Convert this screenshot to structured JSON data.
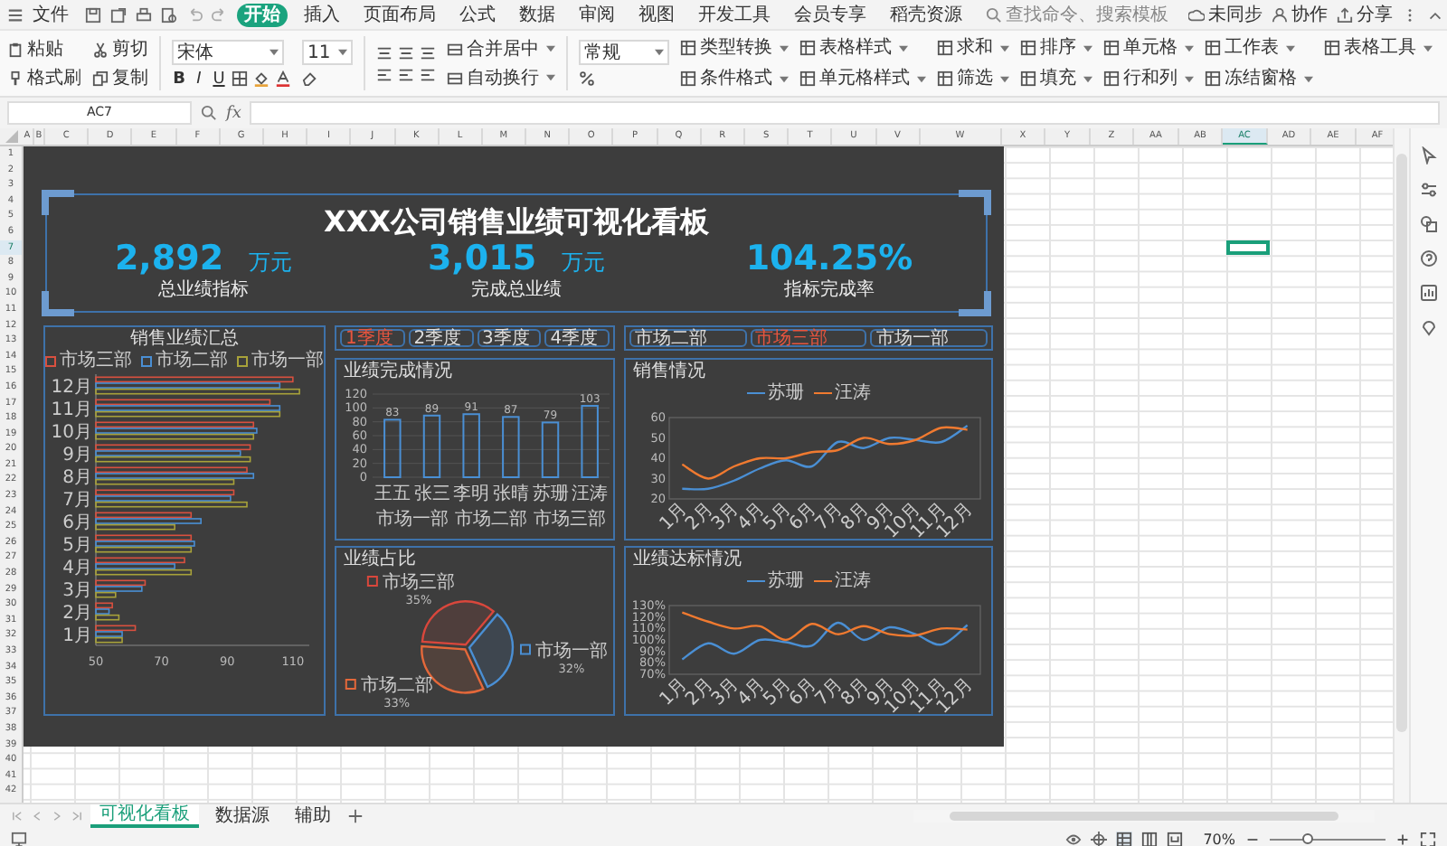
{
  "menu_bar": {
    "file_menu": "文件",
    "tabs": [
      {
        "label": "开始",
        "selected": true
      },
      {
        "label": "插入",
        "selected": false
      },
      {
        "label": "页面布局",
        "selected": false
      },
      {
        "label": "公式",
        "selected": false
      },
      {
        "label": "数据",
        "selected": false
      },
      {
        "label": "审阅",
        "selected": false
      },
      {
        "label": "视图",
        "selected": false
      },
      {
        "label": "开发工具",
        "selected": false
      },
      {
        "label": "会员专享",
        "selected": false
      },
      {
        "label": "稻壳资源",
        "selected": false
      }
    ],
    "search": {
      "placeholder": "查找命令、搜索模板"
    },
    "actions": [
      "未同步",
      "协作",
      "分享"
    ]
  },
  "ribbon": {
    "clipboard": [
      "粘贴",
      "格式刷",
      "剪切",
      "复制"
    ],
    "font": {
      "name": "宋体",
      "size": "11",
      "styles": [
        "B",
        "I",
        "U"
      ]
    },
    "alignment": [
      "合并居中",
      "自动换行"
    ],
    "number_format": "常规",
    "tools": [
      "类型转换",
      "条件格式",
      "表格样式",
      "单元格样式",
      "求和",
      "筛选",
      "排序",
      "填充",
      "单元格",
      "行和列",
      "工作表",
      "冻结窗格",
      "表格工具"
    ]
  },
  "formula_bar": {
    "cell_name": "AC7",
    "function_label": "fx"
  },
  "sheet": {
    "columns": [
      {
        "label": "A",
        "selected": false
      },
      {
        "label": "B",
        "selected": false
      },
      {
        "label": "C",
        "selected": false
      },
      {
        "label": "D",
        "selected": false
      },
      {
        "label": "E",
        "selected": false
      },
      {
        "label": "F",
        "selected": false
      },
      {
        "label": "G",
        "selected": false
      },
      {
        "label": "H",
        "selected": false
      },
      {
        "label": "I",
        "selected": false
      },
      {
        "label": "J",
        "selected": false
      },
      {
        "label": "K",
        "selected": false
      },
      {
        "label": "L",
        "selected": false
      },
      {
        "label": "M",
        "selected": false
      },
      {
        "label": "N",
        "selected": false
      },
      {
        "label": "O",
        "selected": false
      },
      {
        "label": "P",
        "selected": false
      },
      {
        "label": "Q",
        "selected": false
      },
      {
        "label": "R",
        "selected": false
      },
      {
        "label": "S",
        "selected": false
      },
      {
        "label": "T",
        "selected": false
      },
      {
        "label": "U",
        "selected": false
      },
      {
        "label": "V",
        "selected": false
      },
      {
        "label": "W",
        "selected": false
      },
      {
        "label": "X",
        "selected": false
      },
      {
        "label": "Y",
        "selected": false
      },
      {
        "label": "Z",
        "selected": false
      },
      {
        "label": "AA",
        "selected": false
      },
      {
        "label": "AB",
        "selected": false
      },
      {
        "label": "AC",
        "selected": true
      },
      {
        "label": "AD",
        "selected": false
      },
      {
        "label": "AE",
        "selected": false
      },
      {
        "label": "AF",
        "selected": false
      }
    ],
    "rows": [
      {
        "label": "1",
        "selected": false
      },
      {
        "label": "2",
        "selected": false
      },
      {
        "label": "3",
        "selected": false
      },
      {
        "label": "4",
        "selected": false
      },
      {
        "label": "5",
        "selected": false
      },
      {
        "label": "6",
        "selected": false
      },
      {
        "label": "7",
        "selected": true
      },
      {
        "label": "8",
        "selected": false
      },
      {
        "label": "9",
        "selected": false
      },
      {
        "label": "10",
        "selected": false
      },
      {
        "label": "11",
        "selected": false
      },
      {
        "label": "12",
        "selected": false
      },
      {
        "label": "13",
        "selected": false
      },
      {
        "label": "14",
        "selected": false
      },
      {
        "label": "15",
        "selected": false
      },
      {
        "label": "16",
        "selected": false
      },
      {
        "label": "17",
        "selected": false
      },
      {
        "label": "18",
        "selected": false
      },
      {
        "label": "19",
        "selected": false
      },
      {
        "label": "20",
        "selected": false
      },
      {
        "label": "21",
        "selected": false
      },
      {
        "label": "22",
        "selected": false
      },
      {
        "label": "23",
        "selected": false
      },
      {
        "label": "24",
        "selected": false
      },
      {
        "label": "25",
        "selected": false
      },
      {
        "label": "26",
        "selected": false
      },
      {
        "label": "27",
        "selected": false
      },
      {
        "label": "28",
        "selected": false
      },
      {
        "label": "29",
        "selected": false
      },
      {
        "label": "30",
        "selected": false
      },
      {
        "label": "31",
        "selected": false
      },
      {
        "label": "32",
        "selected": false
      },
      {
        "label": "33",
        "selected": false
      },
      {
        "label": "34",
        "selected": false
      },
      {
        "label": "35",
        "selected": false
      },
      {
        "label": "36",
        "selected": false
      },
      {
        "label": "37",
        "selected": false
      },
      {
        "label": "38",
        "selected": false
      },
      {
        "label": "39",
        "selected": false
      },
      {
        "label": "40",
        "selected": false
      },
      {
        "label": "41",
        "selected": false
      },
      {
        "label": "42",
        "selected": false
      }
    ],
    "dashboard": {
      "title": "XXX公司销售业绩可视化看板",
      "kpis": [
        {
          "value": "2,892",
          "unit": "万元",
          "label": "总业绩指标"
        },
        {
          "value": "3,015",
          "unit": "万元",
          "label": "完成总业绩"
        },
        {
          "value": "104.25%",
          "label": "指标完成率"
        }
      ],
      "summary_chart": {
        "chart_data": {
          "type": "bar",
          "orientation": "horizontal",
          "title": "销售业绩汇总",
          "categories": [
            "12月",
            "11月",
            "10月",
            "9月",
            "8月",
            "7月",
            "6月",
            "5月",
            "4月",
            "3月",
            "2月",
            "1月"
          ],
          "series": [
            {
              "name": "市场三部",
              "color": "#d9503f",
              "values": [
                110,
                103,
                98,
                97,
                96,
                92,
                79,
                79,
                77,
                65,
                55,
                62
              ]
            },
            {
              "name": "市场二部",
              "color": "#4a8fd4",
              "values": [
                106,
                106,
                99,
                94,
                98,
                91,
                82,
                80,
                74,
                64,
                54,
                58
              ]
            },
            {
              "name": "市场一部",
              "color": "#a8a23a",
              "values": [
                112,
                106,
                98,
                97,
                92,
                96,
                74,
                79,
                79,
                56,
                57,
                58
              ]
            }
          ],
          "xlim": [
            50,
            115
          ],
          "xticks": [
            50,
            70,
            90,
            110
          ],
          "legend": "top"
        }
      },
      "quarter_buttons": [
        {
          "label": "1季度",
          "selected": true
        },
        {
          "label": "2季度",
          "selected": false
        },
        {
          "label": "3季度",
          "selected": false
        },
        {
          "label": "4季度",
          "selected": false
        }
      ],
      "completion_chart": {
        "chart_data": {
          "type": "bar",
          "title": "业绩完成情况",
          "categories": [
            "王五",
            "张三",
            "李明",
            "张晴",
            "苏珊",
            "汪涛"
          ],
          "values": [
            83,
            89,
            91,
            87,
            79,
            103
          ],
          "ylim": [
            0,
            120
          ],
          "yticks": [
            0,
            20,
            40,
            60,
            80,
            100,
            120
          ],
          "grid": true,
          "data_labels": true
        },
        "group_labels": [
          "市场一部",
          "市场二部",
          "市场三部"
        ]
      },
      "share_chart": {
        "chart_data": {
          "type": "pie",
          "title": "业绩占比",
          "categories": [
            "市场一部",
            "市场二部",
            "市场三部"
          ],
          "values": [
            32,
            33,
            35
          ],
          "colors": [
            "#4a8fd4",
            "#e4683a",
            "#d9473c"
          ],
          "legend": "right",
          "data_labels": true,
          "value_labels": [
            "32%",
            "33%",
            "35%"
          ]
        }
      },
      "department_buttons": [
        {
          "label": "市场二部",
          "selected": false
        },
        {
          "label": "市场三部",
          "selected": true
        },
        {
          "label": "市场一部",
          "selected": false
        }
      ],
      "sales_chart": {
        "chart_data": {
          "type": "line",
          "title": "销售情况",
          "categories": [
            "1月",
            "2月",
            "3月",
            "4月",
            "5月",
            "6月",
            "7月",
            "8月",
            "9月",
            "10月",
            "11月",
            "12月"
          ],
          "series": [
            {
              "name": "苏珊",
              "color": "#4a8fd4",
              "values": [
                25,
                25,
                29,
                35,
                39,
                36,
                48,
                45,
                50,
                49,
                48,
                56
              ]
            },
            {
              "name": "汪涛",
              "color": "#f07a30",
              "values": [
                37,
                30,
                36,
                40,
                40,
                43,
                44,
                50,
                47,
                49,
                55,
                54
              ]
            }
          ],
          "ylim": [
            20,
            60
          ],
          "yticks": [
            20,
            30,
            40,
            50,
            60
          ],
          "legend": "top"
        }
      },
      "target_chart": {
        "chart_data": {
          "type": "line",
          "title": "业绩达标情况",
          "categories": [
            "1月",
            "2月",
            "3月",
            "4月",
            "5月",
            "6月",
            "7月",
            "8月",
            "9月",
            "10月",
            "11月",
            "12月"
          ],
          "series": [
            {
              "name": "苏珊",
              "color": "#4a8fd4",
              "values": [
                83,
                97,
                88,
                100,
                98,
                95,
                115,
                100,
                111,
                105,
                96,
                113
              ]
            },
            {
              "name": "汪涛",
              "color": "#f07a30",
              "values": [
                124,
                116,
                110,
                112,
                100,
                114,
                105,
                112,
                105,
                104,
                110,
                109
              ]
            }
          ],
          "ylim": [
            70,
            130
          ],
          "yticks": [
            {
              "value": 70,
              "label": "70%"
            },
            {
              "value": 80,
              "label": "80%"
            },
            {
              "value": 90,
              "label": "90%"
            },
            {
              "value": 100,
              "label": "100%"
            },
            {
              "value": 110,
              "label": "110%"
            },
            {
              "value": 120,
              "label": "120%"
            },
            {
              "value": 130,
              "label": "130%"
            }
          ],
          "legend": "top"
        }
      }
    }
  },
  "sheet_tabs": [
    {
      "label": "可视化看板",
      "selected": true
    },
    {
      "label": "数据源",
      "selected": false
    },
    {
      "label": "辅助",
      "selected": false
    }
  ],
  "status_bar": {
    "zoom": "70%",
    "zoom_slider": {
      "level": 0.33
    }
  }
}
